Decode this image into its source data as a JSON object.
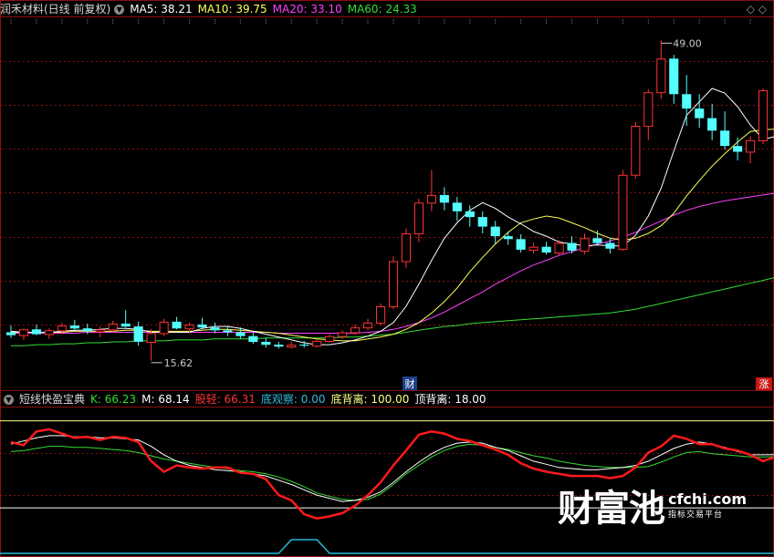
{
  "header": {
    "stock_name": "润禾材料(日线 前复权)",
    "ma_items": [
      {
        "label": "MA5: ",
        "value": "38.21",
        "color": "#ffffff"
      },
      {
        "label": "MA10: ",
        "value": "39.75",
        "color": "#ffff55"
      },
      {
        "label": "MA20: ",
        "value": "33.10",
        "color": "#ff40ff"
      },
      {
        "label": "MA60: ",
        "value": "24.33",
        "color": "#33dd33"
      }
    ],
    "icons": [
      "dropdown-icon",
      "diamond-icon"
    ]
  },
  "indicator_header": {
    "name": "短线快盈宝典",
    "items": [
      {
        "label": "K: ",
        "value": "66.23",
        "color": "#33dd33"
      },
      {
        "label": "M: ",
        "value": "68.14",
        "color": "#ffffff"
      },
      {
        "label": "股轻: ",
        "value": "66.31",
        "color": "#ff3333"
      },
      {
        "label": "底观察: ",
        "value": "0.00",
        "color": "#33bbdd"
      },
      {
        "label": "底背离: ",
        "value": "100.00",
        "color": "#ffff88"
      },
      {
        "label": "顶背离: ",
        "value": "18.00",
        "color": "#ffffff"
      }
    ]
  },
  "annotations": {
    "high_label": "49.00",
    "low_label": "15.62",
    "fin_mark": "财",
    "rise_mark": "涨"
  },
  "watermark": {
    "main": "财富池",
    "site": "cfchi.com",
    "tagline": "指标交易平台"
  },
  "chart_data": {
    "type": "candlestick",
    "price_range": [
      13.8,
      51.5
    ],
    "candles": [
      {
        "o": 18.6,
        "h": 19.3,
        "l": 18.0,
        "c": 18.3
      },
      {
        "o": 18.3,
        "h": 19.0,
        "l": 17.8,
        "c": 18.9
      },
      {
        "o": 18.9,
        "h": 19.4,
        "l": 18.3,
        "c": 18.4
      },
      {
        "o": 18.4,
        "h": 19.0,
        "l": 17.9,
        "c": 18.8
      },
      {
        "o": 18.8,
        "h": 19.6,
        "l": 18.4,
        "c": 19.3
      },
      {
        "o": 19.3,
        "h": 19.9,
        "l": 18.8,
        "c": 19.0
      },
      {
        "o": 19.0,
        "h": 19.5,
        "l": 18.4,
        "c": 18.7
      },
      {
        "o": 18.7,
        "h": 19.2,
        "l": 18.1,
        "c": 18.9
      },
      {
        "o": 18.9,
        "h": 19.8,
        "l": 18.6,
        "c": 19.5
      },
      {
        "o": 19.5,
        "h": 20.9,
        "l": 19.1,
        "c": 19.2
      },
      {
        "o": 19.2,
        "h": 19.7,
        "l": 17.2,
        "c": 17.6
      },
      {
        "o": 17.6,
        "h": 18.9,
        "l": 15.62,
        "c": 18.5
      },
      {
        "o": 18.5,
        "h": 20.0,
        "l": 18.2,
        "c": 19.7
      },
      {
        "o": 19.7,
        "h": 20.2,
        "l": 18.9,
        "c": 19.0
      },
      {
        "o": 19.0,
        "h": 19.6,
        "l": 18.5,
        "c": 19.4
      },
      {
        "o": 19.4,
        "h": 20.1,
        "l": 18.9,
        "c": 19.1
      },
      {
        "o": 19.1,
        "h": 19.6,
        "l": 18.5,
        "c": 18.8
      },
      {
        "o": 18.8,
        "h": 19.3,
        "l": 18.2,
        "c": 18.6
      },
      {
        "o": 18.6,
        "h": 19.1,
        "l": 17.9,
        "c": 18.2
      },
      {
        "o": 18.2,
        "h": 18.6,
        "l": 17.4,
        "c": 17.6
      },
      {
        "o": 17.6,
        "h": 18.0,
        "l": 17.0,
        "c": 17.3
      },
      {
        "o": 17.3,
        "h": 17.6,
        "l": 16.9,
        "c": 17.1
      },
      {
        "o": 17.1,
        "h": 17.6,
        "l": 16.9,
        "c": 17.3
      },
      {
        "o": 17.3,
        "h": 17.7,
        "l": 17.0,
        "c": 17.2
      },
      {
        "o": 17.2,
        "h": 17.9,
        "l": 17.0,
        "c": 17.7
      },
      {
        "o": 17.7,
        "h": 18.4,
        "l": 17.5,
        "c": 18.2
      },
      {
        "o": 18.2,
        "h": 18.8,
        "l": 17.9,
        "c": 18.6
      },
      {
        "o": 18.6,
        "h": 19.4,
        "l": 18.3,
        "c": 19.1
      },
      {
        "o": 19.1,
        "h": 20.0,
        "l": 18.8,
        "c": 19.6
      },
      {
        "o": 19.6,
        "h": 21.6,
        "l": 19.3,
        "c": 21.3
      },
      {
        "o": 21.3,
        "h": 26.5,
        "l": 21.0,
        "c": 26.0
      },
      {
        "o": 26.0,
        "h": 29.4,
        "l": 25.3,
        "c": 28.9
      },
      {
        "o": 28.9,
        "h": 32.5,
        "l": 28.0,
        "c": 32.1
      },
      {
        "o": 32.1,
        "h": 35.5,
        "l": 31.2,
        "c": 32.9
      },
      {
        "o": 32.9,
        "h": 33.7,
        "l": 31.3,
        "c": 32.1
      },
      {
        "o": 32.1,
        "h": 32.7,
        "l": 30.2,
        "c": 31.2
      },
      {
        "o": 31.2,
        "h": 31.8,
        "l": 29.6,
        "c": 30.6
      },
      {
        "o": 30.6,
        "h": 31.2,
        "l": 28.9,
        "c": 29.6
      },
      {
        "o": 29.6,
        "h": 30.2,
        "l": 27.8,
        "c": 28.6
      },
      {
        "o": 28.6,
        "h": 29.1,
        "l": 27.7,
        "c": 28.3
      },
      {
        "o": 28.3,
        "h": 28.8,
        "l": 26.9,
        "c": 27.2
      },
      {
        "o": 27.2,
        "h": 27.9,
        "l": 26.8,
        "c": 27.5
      },
      {
        "o": 27.5,
        "h": 28.0,
        "l": 26.7,
        "c": 26.9
      },
      {
        "o": 26.9,
        "h": 28.2,
        "l": 26.6,
        "c": 27.9
      },
      {
        "o": 27.9,
        "h": 28.6,
        "l": 26.8,
        "c": 27.1
      },
      {
        "o": 27.1,
        "h": 28.9,
        "l": 26.7,
        "c": 28.4
      },
      {
        "o": 28.4,
        "h": 29.2,
        "l": 27.6,
        "c": 27.9
      },
      {
        "o": 27.9,
        "h": 28.4,
        "l": 26.8,
        "c": 27.3
      },
      {
        "o": 27.3,
        "h": 35.5,
        "l": 27.1,
        "c": 35.0
      },
      {
        "o": 35.0,
        "h": 40.5,
        "l": 34.6,
        "c": 40.1
      },
      {
        "o": 40.1,
        "h": 43.9,
        "l": 38.6,
        "c": 43.6
      },
      {
        "o": 43.6,
        "h": 49.0,
        "l": 42.9,
        "c": 47.1
      },
      {
        "o": 47.1,
        "h": 47.5,
        "l": 42.4,
        "c": 43.4
      },
      {
        "o": 43.4,
        "h": 45.4,
        "l": 40.1,
        "c": 41.9
      },
      {
        "o": 41.9,
        "h": 43.4,
        "l": 39.9,
        "c": 40.9
      },
      {
        "o": 40.9,
        "h": 42.4,
        "l": 38.6,
        "c": 39.6
      },
      {
        "o": 39.6,
        "h": 41.6,
        "l": 37.6,
        "c": 38.0
      },
      {
        "o": 38.0,
        "h": 38.9,
        "l": 36.5,
        "c": 37.4
      },
      {
        "o": 37.4,
        "h": 39.0,
        "l": 36.2,
        "c": 38.6
      },
      {
        "o": 38.6,
        "h": 44.0,
        "l": 38.2,
        "c": 43.8
      }
    ],
    "ma5": [
      18.7,
      18.6,
      18.6,
      18.6,
      18.7,
      18.8,
      18.8,
      18.9,
      19.0,
      19.0,
      18.9,
      18.6,
      18.6,
      18.6,
      18.6,
      19.0,
      19.2,
      19.2,
      19.0,
      18.7,
      18.4,
      18.1,
      17.8,
      17.5,
      17.3,
      17.3,
      17.5,
      17.8,
      18.2,
      18.7,
      19.6,
      21.3,
      23.6,
      26.1,
      28.4,
      30.0,
      31.3,
      32.1,
      31.5,
      30.6,
      29.9,
      29.1,
      28.6,
      28.0,
      27.8,
      27.6,
      27.7,
      27.6,
      27.6,
      28.7,
      30.7,
      33.6,
      37.5,
      41.2,
      42.6,
      44.0,
      43.5,
      42.1,
      40.2,
      38.7,
      39.0
    ],
    "ma10": [
      18.6,
      18.6,
      18.6,
      18.6,
      18.6,
      18.7,
      18.7,
      18.7,
      18.7,
      18.8,
      18.8,
      18.7,
      18.7,
      18.7,
      18.7,
      18.8,
      18.9,
      18.9,
      18.8,
      18.7,
      18.6,
      18.5,
      18.3,
      18.1,
      17.9,
      17.8,
      17.7,
      17.7,
      17.9,
      18.1,
      18.4,
      18.9,
      19.6,
      20.6,
      21.8,
      23.2,
      24.9,
      26.4,
      27.8,
      29.0,
      30.0,
      30.4,
      30.7,
      30.5,
      30.0,
      29.5,
      28.9,
      28.4,
      28.2,
      28.4,
      28.9,
      29.7,
      31.0,
      32.8,
      34.4,
      35.9,
      37.2,
      38.4,
      39.5,
      39.7,
      39.75
    ],
    "ma20": [
      18.5,
      18.5,
      18.5,
      18.5,
      18.5,
      18.5,
      18.6,
      18.6,
      18.6,
      18.6,
      18.6,
      18.6,
      18.6,
      18.6,
      18.6,
      18.6,
      18.6,
      18.6,
      18.6,
      18.6,
      18.6,
      18.5,
      18.5,
      18.5,
      18.5,
      18.5,
      18.5,
      18.5,
      18.6,
      18.7,
      18.9,
      19.2,
      19.6,
      20.1,
      20.7,
      21.4,
      22.1,
      22.8,
      23.6,
      24.3,
      25.0,
      25.6,
      26.1,
      26.6,
      27.0,
      27.4,
      27.8,
      28.1,
      28.5,
      29.0,
      29.6,
      30.2,
      30.8,
      31.3,
      31.7,
      32.0,
      32.3,
      32.5,
      32.7,
      32.9,
      33.1
    ],
    "ma60": [
      17.2,
      17.2,
      17.3,
      17.3,
      17.4,
      17.4,
      17.5,
      17.5,
      17.6,
      17.6,
      17.7,
      17.7,
      17.7,
      17.8,
      17.8,
      17.8,
      17.9,
      17.9,
      17.9,
      17.9,
      18.0,
      18.0,
      18.0,
      18.0,
      18.0,
      18.0,
      18.1,
      18.1,
      18.2,
      18.3,
      18.4,
      18.6,
      18.8,
      19.0,
      19.2,
      19.3,
      19.5,
      19.6,
      19.7,
      19.8,
      19.9,
      20.0,
      20.1,
      20.2,
      20.3,
      20.4,
      20.5,
      20.6,
      20.8,
      21.0,
      21.3,
      21.6,
      21.9,
      22.2,
      22.5,
      22.8,
      23.1,
      23.4,
      23.7,
      24.0,
      24.33
    ],
    "indicator": {
      "range": [
        0,
        110
      ],
      "levels": [
        100,
        18
      ],
      "K": [
        71,
        72,
        74,
        76,
        76,
        75,
        75,
        74,
        73,
        72,
        70,
        67,
        64,
        62,
        60,
        58,
        56,
        55,
        53,
        52,
        50,
        47,
        43,
        38,
        32,
        29,
        26,
        25,
        26,
        31,
        40,
        50,
        58,
        66,
        72,
        76,
        78,
        77,
        75,
        73,
        70,
        67,
        65,
        62,
        60,
        58,
        57,
        56,
        56,
        56,
        57,
        61,
        66,
        70,
        71,
        69,
        68,
        67,
        66,
        66,
        66.23
      ],
      "M": [
        78,
        81,
        84,
        86,
        86,
        85,
        85,
        84,
        84,
        83,
        82,
        76,
        68,
        62,
        58,
        56,
        54,
        53,
        52,
        50,
        48,
        44,
        40,
        35,
        30,
        27,
        24,
        25,
        28,
        33,
        42,
        52,
        61,
        69,
        75,
        79,
        80,
        79,
        75,
        72,
        67,
        62,
        59,
        56,
        55,
        54,
        54,
        55,
        56,
        58,
        62,
        68,
        74,
        78,
        80,
        78,
        75,
        71,
        68,
        68,
        68.14
      ],
      "Red": [
        80,
        77,
        90,
        92,
        88,
        84,
        85,
        82,
        85,
        84,
        80,
        62,
        52,
        58,
        56,
        55,
        56,
        56,
        51,
        50,
        45,
        30,
        25,
        12,
        8,
        10,
        13,
        20,
        30,
        42,
        58,
        72,
        87,
        90,
        88,
        83,
        81,
        77,
        73,
        68,
        60,
        55,
        52,
        50,
        48,
        48,
        48,
        46,
        48,
        56,
        70,
        76,
        86,
        83,
        78,
        78,
        74,
        72,
        68,
        62,
        66.31
      ],
      "Cyan": [
        0,
        0,
        0,
        0,
        0,
        0,
        0,
        0,
        0,
        0,
        0,
        0,
        0,
        0,
        0,
        0,
        0,
        0,
        0,
        0,
        0,
        0,
        0,
        0,
        0,
        0,
        0,
        0,
        0,
        0,
        0,
        0,
        0,
        0,
        0,
        0,
        0,
        0,
        0,
        0,
        0,
        0,
        0,
        0,
        0,
        0,
        0,
        0,
        0,
        0,
        0,
        0,
        0,
        0,
        0,
        0,
        0,
        0,
        0,
        0,
        0
      ]
    },
    "bottom_pulse": {
      "range": [
        0,
        1
      ],
      "values": [
        0,
        0,
        0,
        0,
        0,
        0,
        0,
        0,
        0,
        0,
        0,
        0,
        0,
        0,
        0,
        0,
        0,
        0,
        0,
        0,
        0,
        0,
        1,
        1,
        1,
        0,
        0,
        0,
        0,
        0,
        0,
        0,
        0,
        0,
        0,
        0,
        0,
        0,
        0,
        0,
        0,
        0,
        0,
        0,
        0,
        0,
        0,
        0,
        0,
        0,
        0,
        0,
        0,
        0,
        0,
        0,
        0,
        0,
        0,
        0,
        0
      ]
    }
  },
  "colors": {
    "up": "#ff3232",
    "down": "#54ffff",
    "grid": "#8a1010",
    "border": "#8a1010",
    "ma5": "#ffffff",
    "ma10": "#ffff55",
    "ma20": "#ff40ff",
    "ma60": "#33dd33",
    "k": "#33dd33",
    "m": "#ffffff",
    "red": "#ff1a1a",
    "cyan": "#22b8d8"
  }
}
